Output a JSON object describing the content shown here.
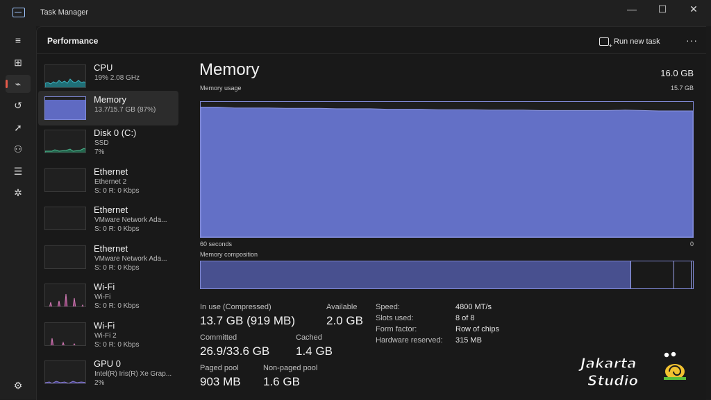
{
  "window": {
    "title": "Task Manager",
    "minimize": "—",
    "maximize": "☐",
    "close": "✕"
  },
  "rail": {
    "icons": [
      "menu-icon",
      "processes-icon",
      "performance-icon",
      "history-icon",
      "startup-icon",
      "users-icon",
      "details-icon",
      "services-icon",
      "settings-icon"
    ]
  },
  "header": {
    "title": "Performance",
    "run_task": "Run new task",
    "more": "···"
  },
  "sidebar": {
    "items": [
      {
        "name": "CPU",
        "line2": "19%  2.08 GHz",
        "line3": "",
        "color": "#3fb3c0",
        "active": false
      },
      {
        "name": "Memory",
        "line2": "13.7/15.7 GB (87%)",
        "line3": "",
        "color": "#7f89d9",
        "active": true
      },
      {
        "name": "Disk 0 (C:)",
        "line2": "SSD",
        "line3": "7%",
        "color": "#4cb890",
        "active": false
      },
      {
        "name": "Ethernet",
        "line2": "Ethernet 2",
        "line3": "S: 0 R: 0 Kbps",
        "color": "#c8a060",
        "active": false
      },
      {
        "name": "Ethernet",
        "line2": "VMware Network Ada...",
        "line3": "S: 0 R: 0 Kbps",
        "color": "#c8a060",
        "active": false
      },
      {
        "name": "Ethernet",
        "line2": "VMware Network Ada...",
        "line3": "S: 0 R: 0 Kbps",
        "color": "#c8a060",
        "active": false
      },
      {
        "name": "Wi-Fi",
        "line2": "Wi-Fi",
        "line3": "S: 0 R: 0 Kbps",
        "color": "#d07ab4",
        "active": false
      },
      {
        "name": "Wi-Fi",
        "line2": "Wi-Fi 2",
        "line3": "S: 0 R: 0 Kbps",
        "color": "#d07ab4",
        "active": false
      },
      {
        "name": "GPU 0",
        "line2": "Intel(R) Iris(R) Xe Grap...",
        "line3": "2%",
        "color": "#8a7fd0",
        "active": false
      }
    ]
  },
  "main": {
    "title": "Memory",
    "total": "16.0 GB",
    "usage_label": "Memory usage",
    "usage_max": "15.7 GB",
    "x_left": "60 seconds",
    "x_right": "0",
    "composition_label": "Memory composition",
    "composition": {
      "in_use_fraction": 0.873,
      "modified_fraction": 0.087,
      "standby_fraction": 0.035
    },
    "graph_color": "#6370c6",
    "usage_series": [
      15.1,
      15.1,
      15.0,
      15.0,
      15.0,
      14.95,
      14.95,
      14.95,
      14.9,
      14.9,
      14.9,
      14.85,
      14.85,
      14.85,
      14.8,
      14.8,
      14.8,
      14.75,
      14.75,
      14.75,
      14.7,
      14.7,
      14.7,
      14.7,
      14.7,
      14.75,
      14.7,
      14.65,
      14.65,
      14.65
    ],
    "usage_ymax": 15.7,
    "stats": [
      {
        "label": "In use (Compressed)",
        "value": "13.7 GB (919 MB)"
      },
      {
        "label": "Available",
        "value": "2.0 GB"
      },
      {
        "label": "Committed",
        "value": "26.9/33.6 GB"
      },
      {
        "label": "Cached",
        "value": "1.4 GB"
      },
      {
        "label": "Paged pool",
        "value": "903 MB"
      },
      {
        "label": "Non-paged pool",
        "value": "1.6 GB"
      }
    ],
    "details": [
      {
        "key": "Speed:",
        "value": "4800 MT/s"
      },
      {
        "key": "Slots used:",
        "value": "8 of 8"
      },
      {
        "key": "Form factor:",
        "value": "Row of chips"
      },
      {
        "key": "Hardware reserved:",
        "value": "315 MB"
      }
    ]
  },
  "watermark": {
    "line1": "Jakarta",
    "line2": "Studio"
  }
}
